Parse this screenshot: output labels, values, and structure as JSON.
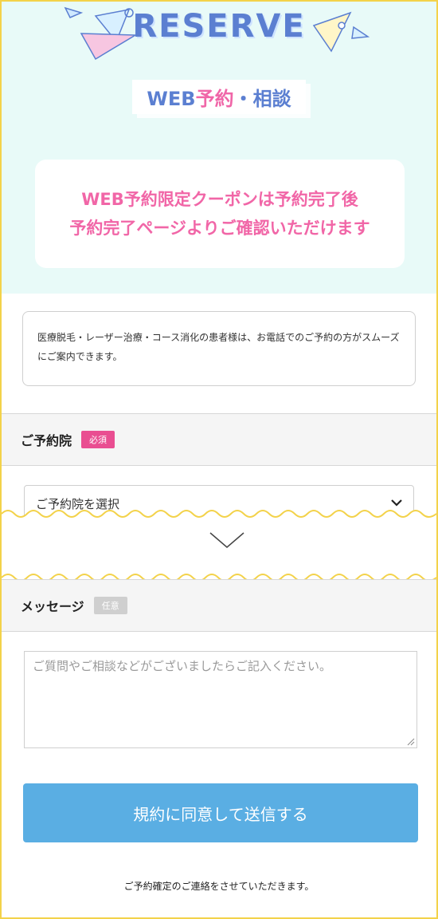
{
  "hero": {
    "heading": "RESERVE",
    "subtitle_blue": "WEB",
    "subtitle_pink": "予約",
    "subtitle_rest": "・相談",
    "coupon_line1": "WEB予約限定クーポンは予約完了後",
    "coupon_line2": "予約完了ページよりご確認いただけます"
  },
  "notice": {
    "text": "医療脱毛・レーザー治療・コース消化の患者様は、お電話でのご予約の方がスムーズにご案内できます。"
  },
  "clinic": {
    "label": "ご予約院",
    "badge": "必須",
    "select_value": "ご予約院を選択"
  },
  "message": {
    "label": "メッセージ",
    "badge": "任意",
    "placeholder": "ご質問やご相談などがございましたらご記入ください。"
  },
  "submit": {
    "label": "規約に同意して送信する"
  },
  "footer": {
    "note": "ご予約確定のご連絡をさせていただきます。"
  },
  "colors": {
    "accent_blue": "#5b7fd1",
    "accent_pink": "#f166a7",
    "button_blue": "#5aaee3",
    "required_pink": "#e94e91",
    "frame_yellow": "#f3d24a"
  }
}
